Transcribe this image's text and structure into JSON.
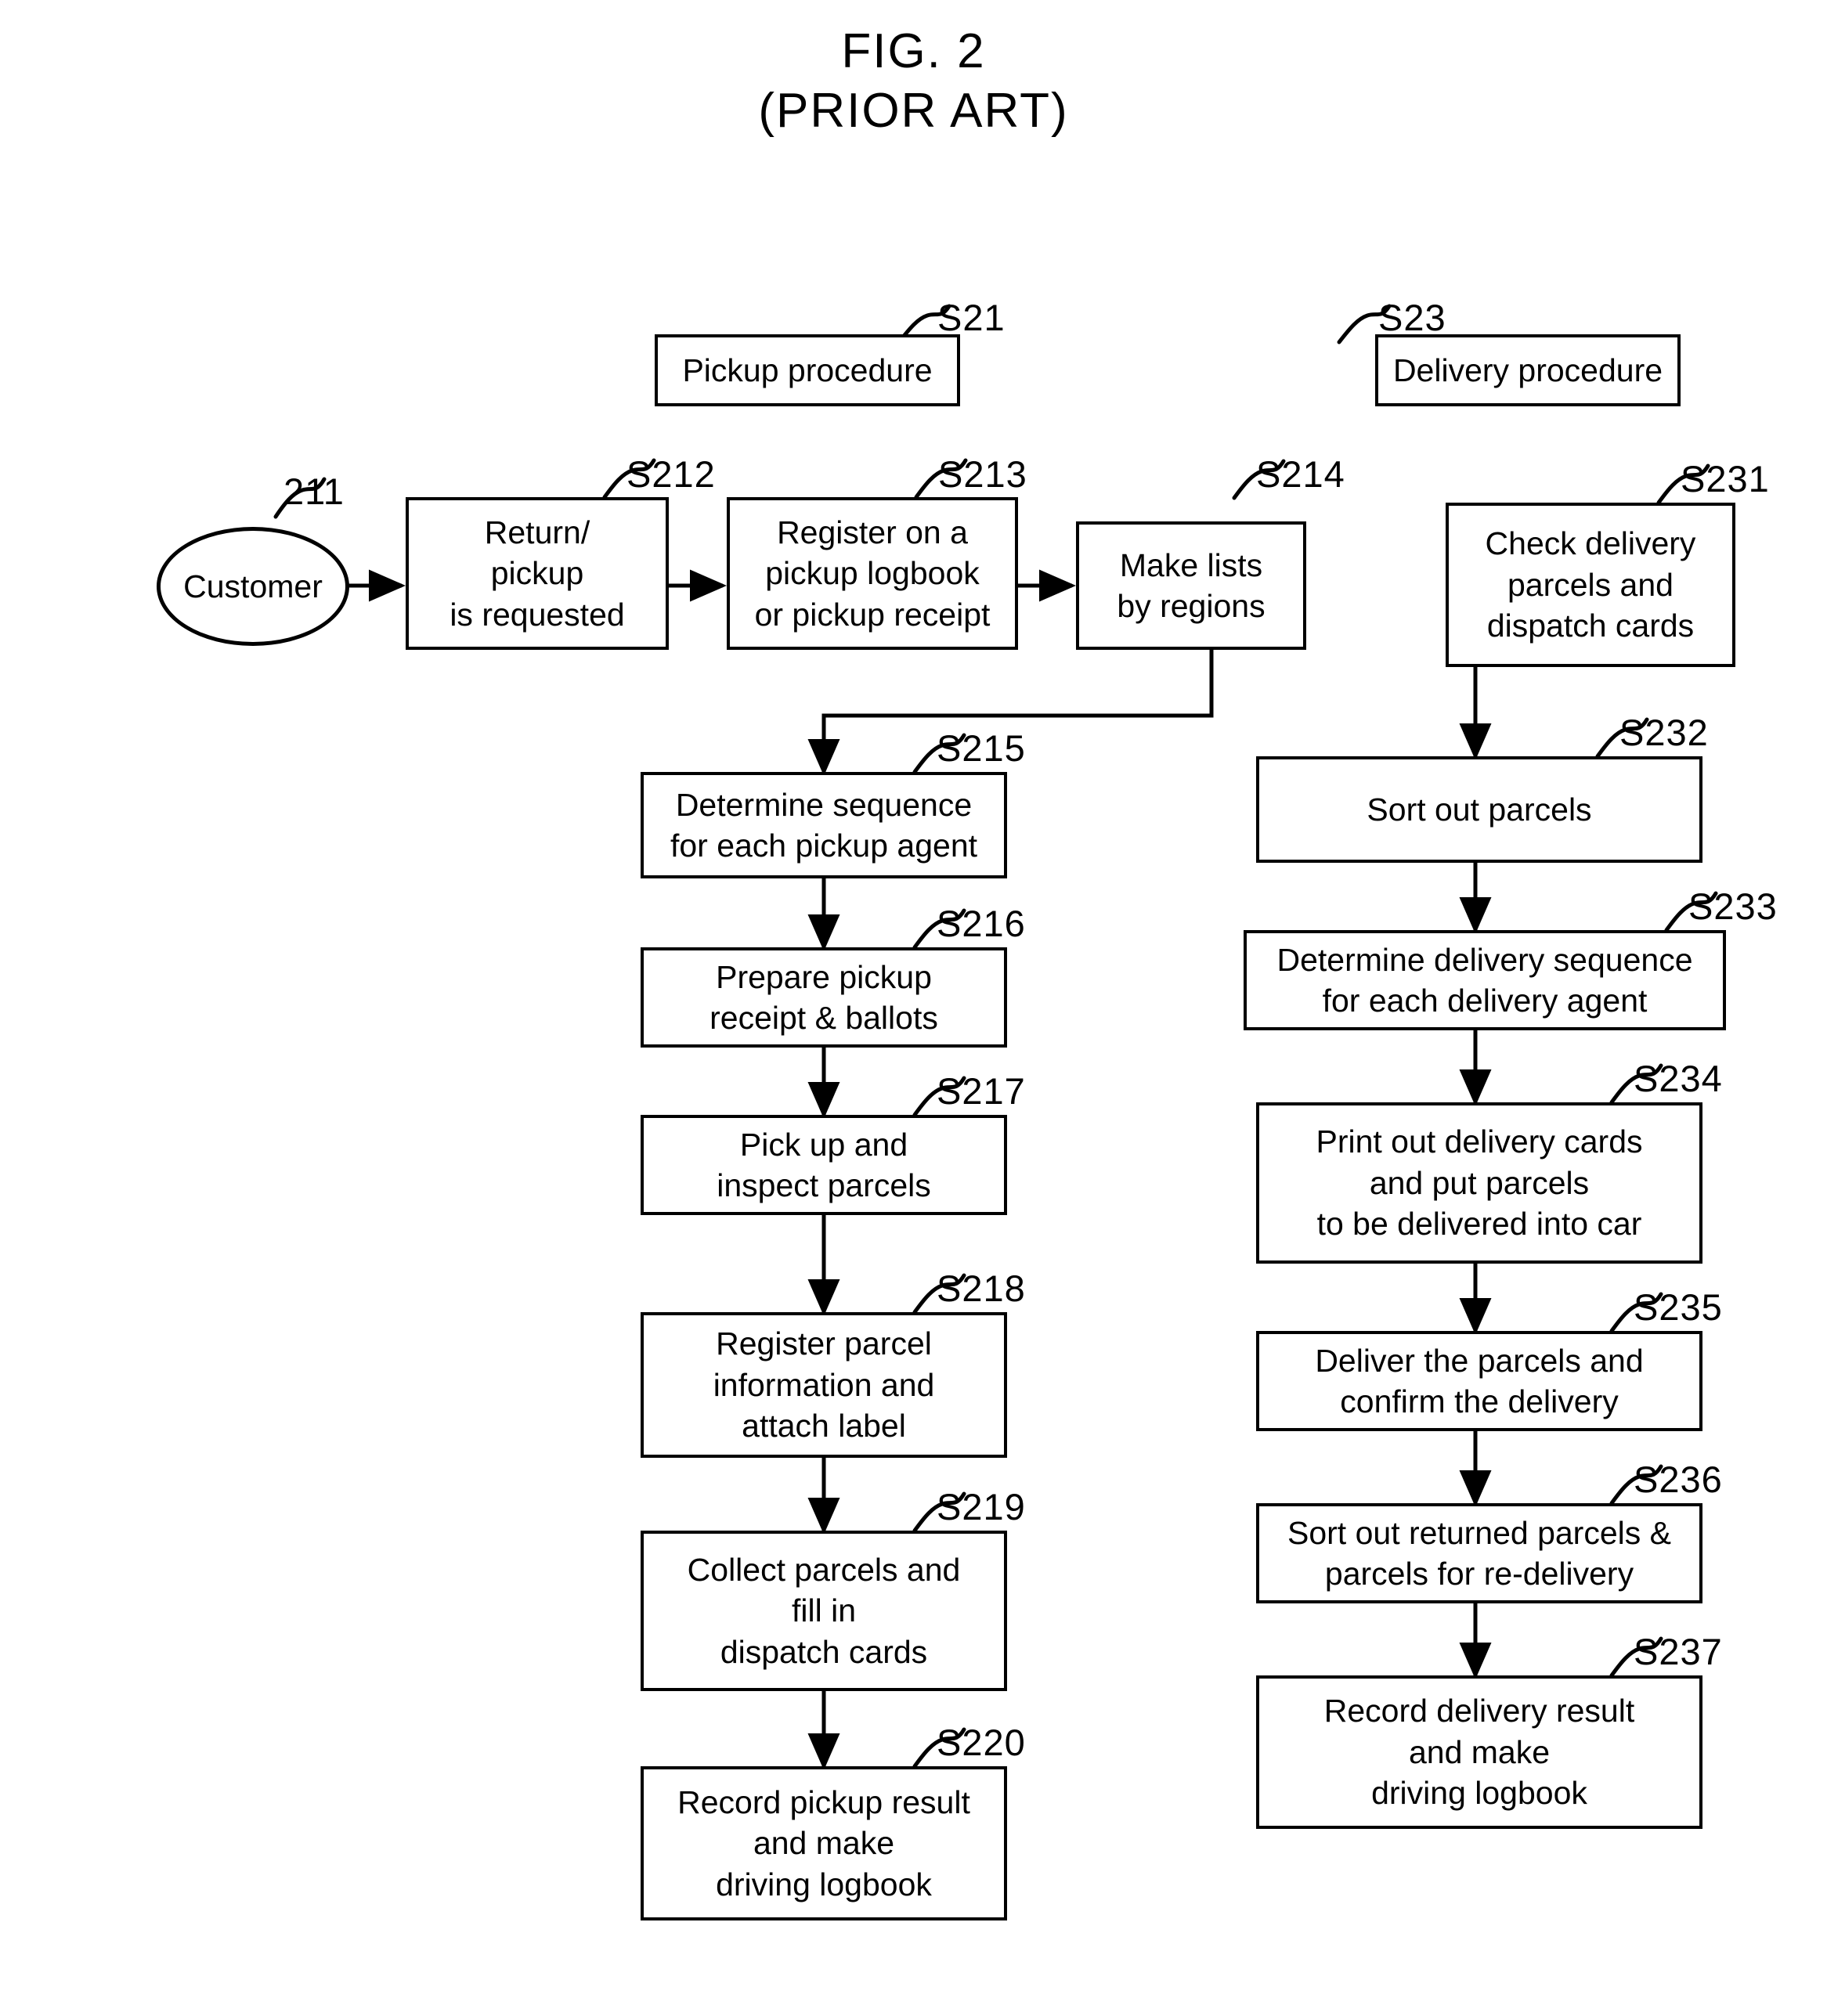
{
  "figure": {
    "title_line1": "FIG. 2",
    "title_line2": "(PRIOR ART)"
  },
  "headers": [
    {
      "id": "S21",
      "label": "Pickup procedure",
      "ref": "S21"
    },
    {
      "id": "S23",
      "label": "Delivery procedure",
      "ref": "S23"
    }
  ],
  "actor": {
    "ref": "211",
    "label": "Customer"
  },
  "pickup_flow": [
    {
      "ref": "S212",
      "label": "Return/\npickup\nis requested"
    },
    {
      "ref": "S213",
      "label": "Register on a\npickup logbook\nor pickup receipt"
    },
    {
      "ref": "S214",
      "label": "Make lists\nby regions"
    },
    {
      "ref": "S215",
      "label": "Determine sequence\nfor each pickup agent"
    },
    {
      "ref": "S216",
      "label": "Prepare pickup\nreceipt & ballots"
    },
    {
      "ref": "S217",
      "label": "Pick up and\ninspect parcels"
    },
    {
      "ref": "S218",
      "label": "Register parcel\ninformation and\nattach label"
    },
    {
      "ref": "S219",
      "label": "Collect parcels and\nfill in\ndispatch cards"
    },
    {
      "ref": "S220",
      "label": "Record pickup result\nand make\ndriving logbook"
    }
  ],
  "delivery_flow": [
    {
      "ref": "S231",
      "label": "Check delivery\nparcels and\ndispatch cards"
    },
    {
      "ref": "S232",
      "label": "Sort out parcels"
    },
    {
      "ref": "S233",
      "label": "Determine delivery sequence\nfor each delivery agent"
    },
    {
      "ref": "S234",
      "label": "Print out delivery cards\nand put parcels\nto be delivered into car"
    },
    {
      "ref": "S235",
      "label": "Deliver the parcels and\nconfirm the delivery"
    },
    {
      "ref": "S236",
      "label": "Sort out returned parcels &\nparcels for re-delivery"
    },
    {
      "ref": "S237",
      "label": "Record delivery result\nand make\ndriving logbook"
    }
  ],
  "colors": {
    "ink": "#000000",
    "paper": "#ffffff"
  }
}
